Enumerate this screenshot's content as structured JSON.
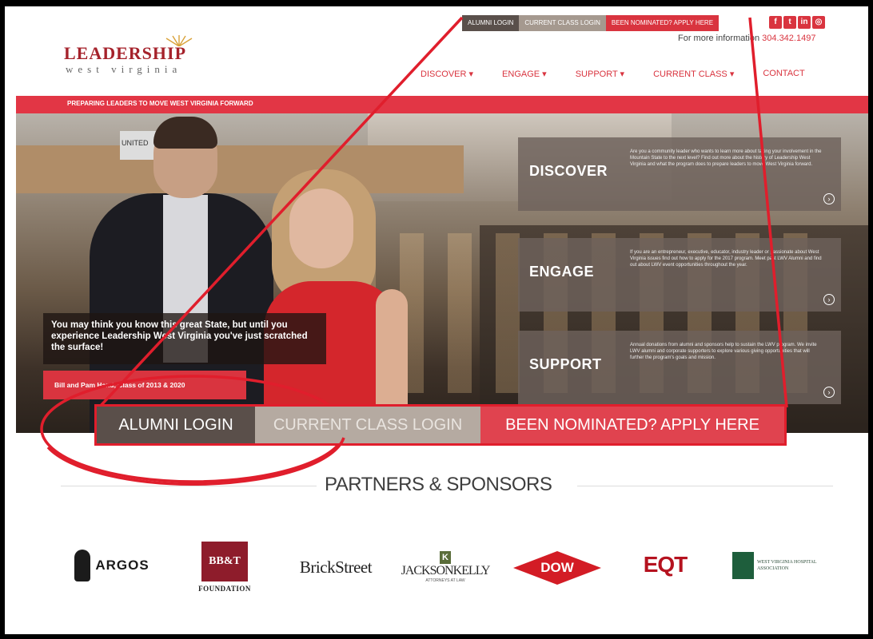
{
  "header": {
    "logo": {
      "title": "LEADERSHIP",
      "subtitle": "west virginia"
    },
    "top_links": {
      "alumni": "ALUMNI LOGIN",
      "current": "CURRENT CLASS LOGIN",
      "apply": "BEEN NOMINATED? APPLY HERE"
    },
    "social": [
      {
        "icon": "facebook-icon",
        "glyph": "f"
      },
      {
        "icon": "twitter-icon",
        "glyph": "t"
      },
      {
        "icon": "linkedin-icon",
        "glyph": "in"
      },
      {
        "icon": "instagram-icon",
        "glyph": "◎"
      }
    ],
    "info_label": "For more information",
    "phone": "304.342.1497",
    "nav": {
      "discover": "DISCOVER ▾",
      "engage": "ENGAGE ▾",
      "support": "SUPPORT ▾",
      "current_class": "CURRENT CLASS ▾",
      "contact": "CONTACT"
    },
    "tagline": "PREPARING LEADERS TO MOVE WEST VIRGINIA FORWARD"
  },
  "hero": {
    "sign": "UNITED",
    "quote": "You may think you know this great State, but until you experience Leadership West Virginia you've just scratched the surface!",
    "quote_button": "Bill and Pam Hand, Class of 2013 & 2020",
    "panels": {
      "discover": {
        "title": "DISCOVER",
        "desc": "Are you a community leader who wants to learn more about taking your involvement in the Mountain State to the next level? Find out more about the history of Leadership West Virginia and what the program does to prepare leaders to move West Virginia forward."
      },
      "engage": {
        "title": "ENGAGE",
        "desc": "If you are an entrepreneur, executive, educator, industry leader or passionate about West Virginia issues find out how to apply for the 2017 program. Meet past LWV Alumni and find out about LWV event opportunities throughout the year."
      },
      "support": {
        "title": "SUPPORT",
        "desc": "Annual donations from alumni and sponsors help to sustain the LWV program. We invite LWV alumni and corporate supporters to explore various giving opportunities that will further the program's goals and mission."
      }
    },
    "arrow_glyph": "›"
  },
  "zoom_bar": {
    "alumni": "ALUMNI LOGIN",
    "current": "CURRENT CLASS LOGIN",
    "apply": "BEEN NOMINATED? APPLY HERE"
  },
  "partners": {
    "title": "PARTNERS & SPONSORS",
    "argos": "ARGOS",
    "bbt": "BB&T",
    "bbt_caption": "FOUNDATION",
    "brickstreet": "BrickStreet",
    "jk_mark": "K",
    "jacksonkelly": "JACKSONKELLY",
    "jk_sub": "ATTORNEYS AT LAW",
    "dow": "DOW",
    "eqt": "EQT",
    "wvha": "WEST VIRGINIA HOSPITAL ASSOCIATION"
  },
  "colors": {
    "accent": "#d9343f",
    "annotation": "#e01e2c",
    "alumni_bg": "#5a504b",
    "current_bg": "#a5998f"
  }
}
